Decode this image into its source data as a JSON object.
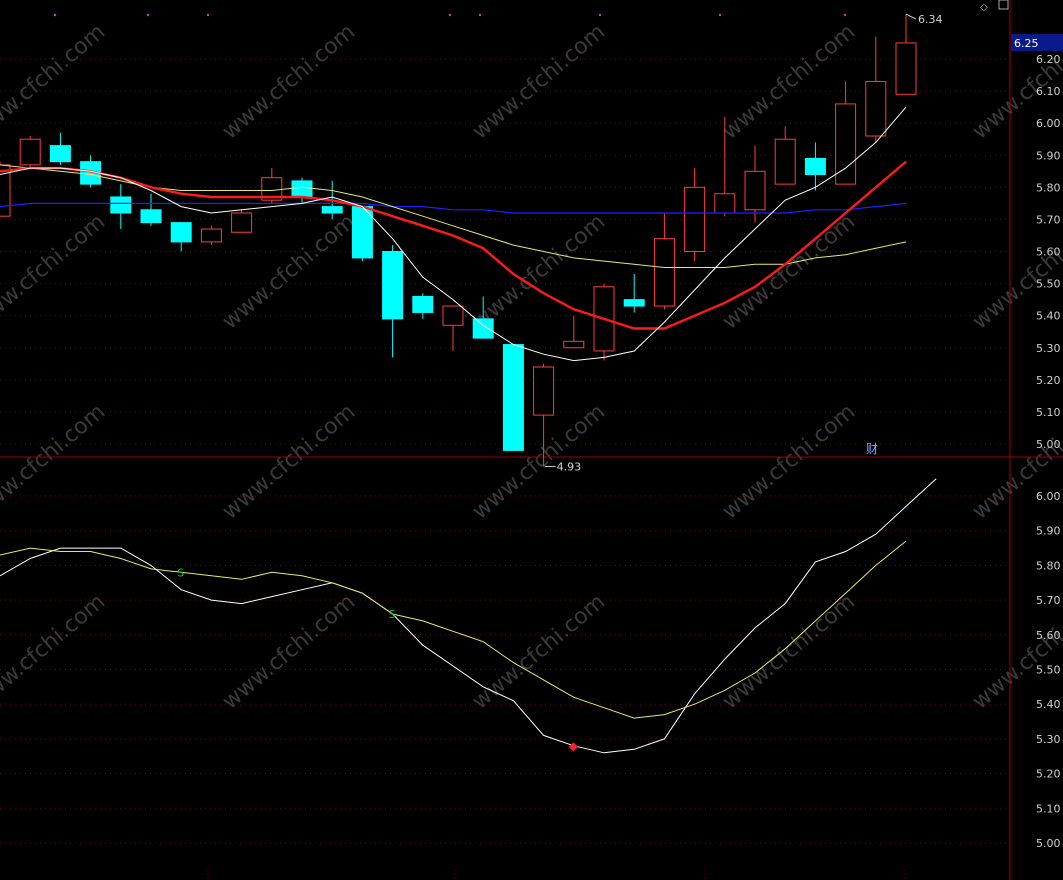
{
  "colors": {
    "background": "#000000",
    "grid": "#7a0000",
    "border": "#a00000",
    "up_candle": "#ff3b3b",
    "down_candle": "#00ffff",
    "ma_white": "#ffffff",
    "ma_red": "#ff1a1a",
    "ma_yellow": "#e8e870",
    "ma_blue": "#2020ff",
    "axis_text": "#d0d0d0",
    "price_tag_bg": "#0a1a8a",
    "signal_green": "#1ec81e",
    "signal_red": "#ff2020"
  },
  "watermark": "www.cfchi.com",
  "upper_panel": {
    "current_price_tag": "6.25",
    "high_label": "6.34",
    "low_label": "4.93",
    "fin_marker": "财",
    "ylim": [
      4.88,
      6.4
    ]
  },
  "lower_panel": {
    "ylim": [
      4.94,
      6.14
    ],
    "signal_s1": "S",
    "signal_s2": "S",
    "signal_diamond": "◆"
  },
  "chart_data": [
    {
      "type": "candlestick",
      "y_ticks": [
        "6.20",
        "6.10",
        "6.00",
        "5.90",
        "5.80",
        "5.70",
        "5.60",
        "5.50",
        "5.40",
        "5.30",
        "5.20",
        "5.10",
        "5.00"
      ],
      "y_tick_values": [
        6.2,
        6.1,
        6.0,
        5.9,
        5.8,
        5.7,
        5.6,
        5.5,
        5.4,
        5.3,
        5.2,
        5.1,
        5.0
      ],
      "candles": [
        {
          "o": 5.71,
          "c": 5.87,
          "h": 5.88,
          "l": 5.71
        },
        {
          "o": 5.87,
          "c": 5.95,
          "h": 5.96,
          "l": 5.86
        },
        {
          "o": 5.93,
          "c": 5.88,
          "h": 5.97,
          "l": 5.87
        },
        {
          "o": 5.88,
          "c": 5.81,
          "h": 5.9,
          "l": 5.8
        },
        {
          "o": 5.77,
          "c": 5.72,
          "h": 5.81,
          "l": 5.67
        },
        {
          "o": 5.73,
          "c": 5.69,
          "h": 5.78,
          "l": 5.68
        },
        {
          "o": 5.69,
          "c": 5.63,
          "h": 5.69,
          "l": 5.6
        },
        {
          "o": 5.63,
          "c": 5.67,
          "h": 5.68,
          "l": 5.62
        },
        {
          "o": 5.66,
          "c": 5.72,
          "h": 5.73,
          "l": 5.66
        },
        {
          "o": 5.76,
          "c": 5.83,
          "h": 5.86,
          "l": 5.75
        },
        {
          "o": 5.82,
          "c": 5.77,
          "h": 5.83,
          "l": 5.75
        },
        {
          "o": 5.74,
          "c": 5.72,
          "h": 5.82,
          "l": 5.7
        },
        {
          "o": 5.74,
          "c": 5.58,
          "h": 5.74,
          "l": 5.57
        },
        {
          "o": 5.6,
          "c": 5.39,
          "h": 5.62,
          "l": 5.27
        },
        {
          "o": 5.46,
          "c": 5.41,
          "h": 5.47,
          "l": 5.39
        },
        {
          "o": 5.37,
          "c": 5.43,
          "h": 5.43,
          "l": 5.29
        },
        {
          "o": 5.39,
          "c": 5.33,
          "h": 5.46,
          "l": 5.33
        },
        {
          "o": 5.31,
          "c": 4.98,
          "h": 5.31,
          "l": 4.98
        },
        {
          "o": 5.09,
          "c": 5.24,
          "h": 5.25,
          "l": 4.93
        },
        {
          "o": 5.3,
          "c": 5.32,
          "h": 5.4,
          "l": 5.3
        },
        {
          "o": 5.29,
          "c": 5.49,
          "h": 5.5,
          "l": 5.26
        },
        {
          "o": 5.45,
          "c": 5.43,
          "h": 5.53,
          "l": 5.41
        },
        {
          "o": 5.43,
          "c": 5.64,
          "h": 5.72,
          "l": 5.42
        },
        {
          "o": 5.6,
          "c": 5.8,
          "h": 5.86,
          "l": 5.57
        },
        {
          "o": 5.72,
          "c": 5.78,
          "h": 6.02,
          "l": 5.71
        },
        {
          "o": 5.73,
          "c": 5.85,
          "h": 5.93,
          "l": 5.69
        },
        {
          "o": 5.81,
          "c": 5.95,
          "h": 5.99,
          "l": 5.81
        },
        {
          "o": 5.89,
          "c": 5.84,
          "h": 5.94,
          "l": 5.79
        },
        {
          "o": 5.81,
          "c": 6.06,
          "h": 6.13,
          "l": 5.81
        },
        {
          "o": 5.96,
          "c": 6.13,
          "h": 6.27,
          "l": 5.94
        },
        {
          "o": 6.09,
          "c": 6.25,
          "h": 6.34,
          "l": 6.09
        }
      ],
      "ma_white": [
        5.84,
        5.86,
        5.86,
        5.85,
        5.83,
        5.79,
        5.74,
        5.72,
        5.73,
        5.74,
        5.75,
        5.77,
        5.74,
        5.64,
        5.52,
        5.45,
        5.37,
        5.31,
        5.28,
        5.26,
        5.27,
        5.29,
        5.38,
        5.48,
        5.58,
        5.67,
        5.76,
        5.8,
        5.86,
        5.94,
        6.05
      ],
      "ma_red": [
        5.85,
        5.86,
        5.86,
        5.85,
        5.83,
        5.8,
        5.78,
        5.77,
        5.77,
        5.77,
        5.77,
        5.76,
        5.74,
        5.71,
        5.68,
        5.65,
        5.61,
        5.53,
        5.47,
        5.42,
        5.39,
        5.36,
        5.36,
        5.4,
        5.44,
        5.49,
        5.56,
        5.64,
        5.72,
        5.8,
        5.88
      ],
      "ma_yellow": [
        5.87,
        5.86,
        5.85,
        5.84,
        5.82,
        5.8,
        5.79,
        5.79,
        5.79,
        5.79,
        5.8,
        5.79,
        5.77,
        5.74,
        5.71,
        5.68,
        5.65,
        5.62,
        5.6,
        5.58,
        5.57,
        5.56,
        5.55,
        5.55,
        5.55,
        5.56,
        5.56,
        5.58,
        5.59,
        5.61,
        5.63
      ],
      "ma_blue": [
        5.74,
        5.75,
        5.75,
        5.75,
        5.75,
        5.75,
        5.75,
        5.75,
        5.75,
        5.75,
        5.75,
        5.75,
        5.75,
        5.74,
        5.74,
        5.73,
        5.73,
        5.72,
        5.72,
        5.72,
        5.72,
        5.72,
        5.72,
        5.72,
        5.72,
        5.72,
        5.72,
        5.73,
        5.73,
        5.74,
        5.75
      ]
    },
    {
      "type": "line",
      "y_ticks": [
        "6.00",
        "5.90",
        "5.80",
        "5.70",
        "5.60",
        "5.50",
        "5.40",
        "5.30",
        "5.20",
        "5.10",
        "5.00"
      ],
      "y_tick_values": [
        6.0,
        5.9,
        5.8,
        5.7,
        5.6,
        5.5,
        5.4,
        5.3,
        5.2,
        5.1,
        5.0
      ],
      "series": [
        {
          "color": "#ffffff",
          "values": [
            5.77,
            5.82,
            5.85,
            5.85,
            5.85,
            5.8,
            5.73,
            5.7,
            5.69,
            5.71,
            5.73,
            5.75,
            5.72,
            5.66,
            5.57,
            5.51,
            5.45,
            5.41,
            5.31,
            5.28,
            5.26,
            5.27,
            5.3,
            5.43,
            5.53,
            5.62,
            5.69,
            5.81,
            5.84,
            5.89,
            5.97,
            6.05
          ]
        },
        {
          "color": "#e8e870",
          "values": [
            5.83,
            5.85,
            5.84,
            5.84,
            5.82,
            5.79,
            5.78,
            5.77,
            5.76,
            5.78,
            5.77,
            5.75,
            5.72,
            5.66,
            5.64,
            5.61,
            5.58,
            5.52,
            5.47,
            5.42,
            5.39,
            5.36,
            5.37,
            5.4,
            5.44,
            5.49,
            5.56,
            5.64,
            5.72,
            5.8,
            5.87
          ]
        }
      ],
      "signals": [
        {
          "index": 6,
          "label": "S"
        },
        {
          "index": 13,
          "label": "S"
        },
        {
          "index": 19,
          "label": "◆"
        }
      ]
    }
  ]
}
